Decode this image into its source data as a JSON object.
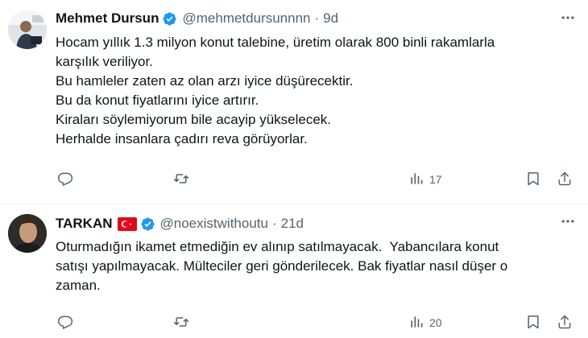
{
  "tweets": [
    {
      "author_name": "Mehmet Dursun",
      "handle": "@mehmetdursunnnn",
      "separator": "·",
      "time": "9d",
      "verified": true,
      "flag": null,
      "lines": [
        "Hocam yıllık 1.3 milyon konut talebine, üretim olarak 800 binli rakamlarla",
        "karşılık veriliyor.",
        "Bu hamleler zaten az olan arzı iyice düşürecektir.",
        "Bu da konut fiyatlarını iyice artırır.",
        "Kiraları söylemiyorum bile acayip yükselecek.",
        "Herhalde insanlara çadırı reva görüyorlar."
      ],
      "views": "17",
      "icons": [
        "reply-icon",
        "retweet-icon",
        "views-icon",
        "bookmark-icon",
        "share-icon"
      ]
    },
    {
      "author_name": "TARKAN",
      "handle": "@noexistwithoutu",
      "separator": "·",
      "time": "21d",
      "verified": true,
      "flag": "turkey-flag",
      "lines": [
        "Oturmadığın ikamet etmediğin ev alınıp satılmayacak.  Yabancılara konut",
        "satışı yapılmayacak. Mülteciler geri gönderilecek. Bak fiyatlar nasıl düşer o",
        "zaman."
      ],
      "views": "20",
      "icons": [
        "reply-icon",
        "retweet-icon",
        "views-icon",
        "bookmark-icon",
        "share-icon"
      ]
    }
  ],
  "colors": {
    "text": "#0f1419",
    "secondary": "#536471",
    "verified": "#1d9bf0",
    "divider": "#eff3f4",
    "flag_red": "#e30a17"
  }
}
